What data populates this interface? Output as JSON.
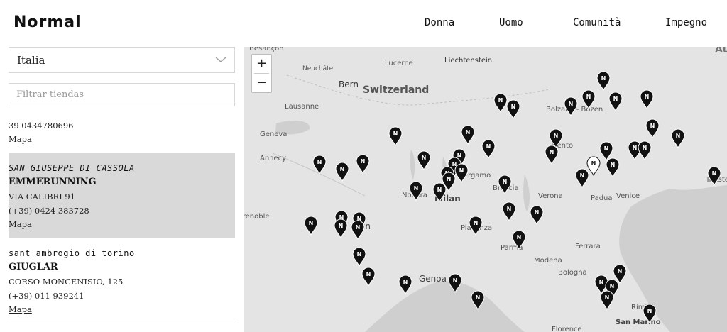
{
  "header": {
    "logo": "Normal",
    "nav": [
      "Donna",
      "Uomo",
      "Comunità",
      "Impegno"
    ]
  },
  "sidebar": {
    "country_select": {
      "value": "Italia"
    },
    "filter": {
      "placeholder": "Filtrar tiendas"
    },
    "partial_store": {
      "phone": "39 0434780696",
      "map_link": "Mapa"
    },
    "stores": [
      {
        "city": "SAN GIUSEPPE DI CASSOLA",
        "name": "EMMERUNNING",
        "address": "VIA CALIBRI 91",
        "phone": "(+39) 0424 383728",
        "map_link": "Mapa"
      },
      {
        "city": "sant'ambrogio di torino",
        "name": "GIUGLAR",
        "address": "CORSO MONCENISIO, 125",
        "phone": "(+39) 011 939241",
        "map_link": "Mapa"
      }
    ]
  },
  "map": {
    "zoom_in": "+",
    "zoom_out": "−",
    "labels": [
      "Besançon",
      "Neuchâtel",
      "Bern",
      "Lucerne",
      "Liechtenstein",
      "Switzerland",
      "Lausanne",
      "Geneva",
      "Annecy",
      "Bolzano - Bozen",
      "Trento",
      "Bergamo",
      "Milan",
      "Novara",
      "Brescia",
      "Verona",
      "Padua",
      "Venice",
      "Trieste",
      "Grenoble",
      "Turin",
      "Piacenza",
      "Parma",
      "Modena",
      "Ferrara",
      "Bologna",
      "Genoa",
      "Rimini",
      "San Marino",
      "Florence",
      "Au"
    ]
  },
  "colors": {
    "map_bg": "#e4e4e4",
    "water": "#cfcfcf",
    "highlight": "#d9d9d9",
    "pin": "#111111"
  }
}
